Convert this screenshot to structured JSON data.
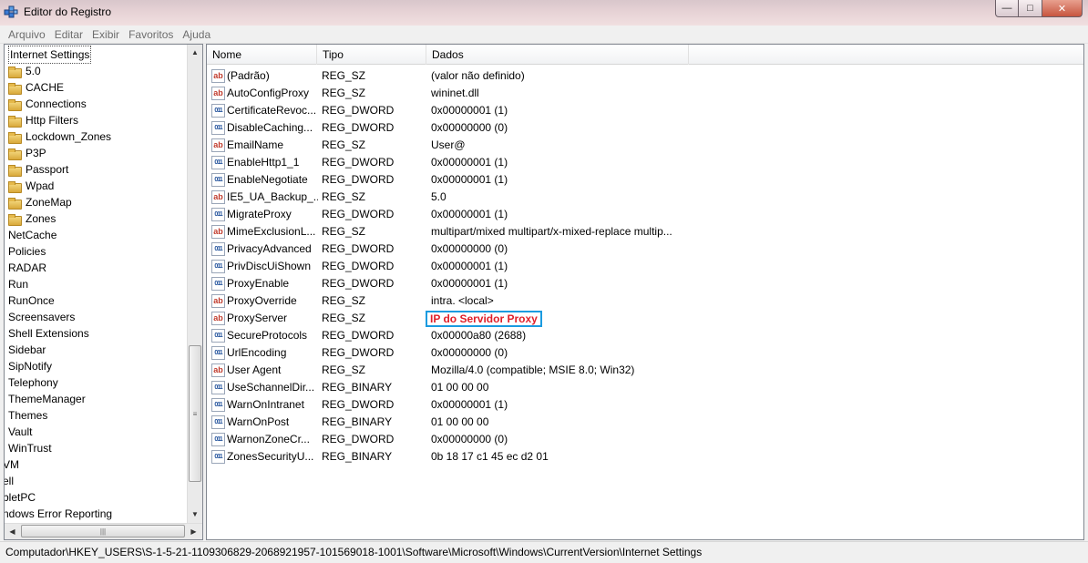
{
  "window": {
    "title": "Editor do Registro",
    "icons": {
      "app": "registry-editor-icon",
      "minimize": "minimize-icon",
      "maximize": "maximize-icon",
      "close": "close-icon"
    }
  },
  "menu": [
    "Arquivo",
    "Editar",
    "Exibir",
    "Favoritos",
    "Ajuda"
  ],
  "tree": [
    {
      "label": "Internet Settings",
      "folder": false,
      "selected": true,
      "indent": 1
    },
    {
      "label": "5.0",
      "folder": true,
      "indent": 1
    },
    {
      "label": "CACHE",
      "folder": true,
      "indent": 1
    },
    {
      "label": "Connections",
      "folder": true,
      "indent": 1
    },
    {
      "label": "Http Filters",
      "folder": true,
      "indent": 1
    },
    {
      "label": "Lockdown_Zones",
      "folder": true,
      "indent": 1
    },
    {
      "label": "P3P",
      "folder": true,
      "indent": 1
    },
    {
      "label": "Passport",
      "folder": true,
      "indent": 1
    },
    {
      "label": "Wpad",
      "folder": true,
      "indent": 1
    },
    {
      "label": "ZoneMap",
      "folder": true,
      "indent": 1
    },
    {
      "label": "Zones",
      "folder": true,
      "indent": 1
    },
    {
      "label": "NetCache",
      "folder": false,
      "indent": 1
    },
    {
      "label": "Policies",
      "folder": false,
      "indent": 1
    },
    {
      "label": "RADAR",
      "folder": false,
      "indent": 1
    },
    {
      "label": "Run",
      "folder": false,
      "indent": 1
    },
    {
      "label": "RunOnce",
      "folder": false,
      "indent": 1
    },
    {
      "label": "Screensavers",
      "folder": false,
      "indent": 1
    },
    {
      "label": "Shell Extensions",
      "folder": false,
      "indent": 1
    },
    {
      "label": "Sidebar",
      "folder": false,
      "indent": 1
    },
    {
      "label": "SipNotify",
      "folder": false,
      "indent": 1
    },
    {
      "label": "Telephony",
      "folder": false,
      "indent": 1
    },
    {
      "label": "ThemeManager",
      "folder": false,
      "indent": 1
    },
    {
      "label": "Themes",
      "folder": false,
      "indent": 1
    },
    {
      "label": "Vault",
      "folder": false,
      "indent": 1
    },
    {
      "label": "WinTrust",
      "folder": false,
      "indent": 1
    },
    {
      "label": "VM",
      "folder": false,
      "indent": 0
    },
    {
      "label": "ell",
      "folder": false,
      "indent": 0
    },
    {
      "label": "bletPC",
      "folder": false,
      "indent": 0
    },
    {
      "label": "ndows Error Reporting",
      "folder": false,
      "indent": 0
    }
  ],
  "columns": {
    "name": "Nome",
    "type": "Tipo",
    "data": "Dados"
  },
  "values": [
    {
      "name": "(Padrão)",
      "type": "REG_SZ",
      "data": "(valor não definido)",
      "kind": "str"
    },
    {
      "name": "AutoConfigProxy",
      "type": "REG_SZ",
      "data": "wininet.dll",
      "kind": "str"
    },
    {
      "name": "CertificateRevoc...",
      "type": "REG_DWORD",
      "data": "0x00000001 (1)",
      "kind": "bin"
    },
    {
      "name": "DisableCaching...",
      "type": "REG_DWORD",
      "data": "0x00000000 (0)",
      "kind": "bin"
    },
    {
      "name": "EmailName",
      "type": "REG_SZ",
      "data": "User@",
      "kind": "str"
    },
    {
      "name": "EnableHttp1_1",
      "type": "REG_DWORD",
      "data": "0x00000001 (1)",
      "kind": "bin"
    },
    {
      "name": "EnableNegotiate",
      "type": "REG_DWORD",
      "data": "0x00000001 (1)",
      "kind": "bin"
    },
    {
      "name": "IE5_UA_Backup_...",
      "type": "REG_SZ",
      "data": "5.0",
      "kind": "str"
    },
    {
      "name": "MigrateProxy",
      "type": "REG_DWORD",
      "data": "0x00000001 (1)",
      "kind": "bin"
    },
    {
      "name": "MimeExclusionL...",
      "type": "REG_SZ",
      "data": "multipart/mixed multipart/x-mixed-replace multip...",
      "kind": "str"
    },
    {
      "name": "PrivacyAdvanced",
      "type": "REG_DWORD",
      "data": "0x00000000 (0)",
      "kind": "bin"
    },
    {
      "name": "PrivDiscUiShown",
      "type": "REG_DWORD",
      "data": "0x00000001 (1)",
      "kind": "bin"
    },
    {
      "name": "ProxyEnable",
      "type": "REG_DWORD",
      "data": "0x00000001 (1)",
      "kind": "bin"
    },
    {
      "name": "ProxyOverride",
      "type": "REG_SZ",
      "data": "intra. <local>",
      "kind": "str"
    },
    {
      "name": "ProxyServer",
      "type": "REG_SZ",
      "data": "IP do Servidor Proxy",
      "kind": "str",
      "highlight": true
    },
    {
      "name": "SecureProtocols",
      "type": "REG_DWORD",
      "data": "0x00000a80 (2688)",
      "kind": "bin"
    },
    {
      "name": "UrlEncoding",
      "type": "REG_DWORD",
      "data": "0x00000000 (0)",
      "kind": "bin"
    },
    {
      "name": "User Agent",
      "type": "REG_SZ",
      "data": "Mozilla/4.0 (compatible; MSIE 8.0; Win32)",
      "kind": "str"
    },
    {
      "name": "UseSchannelDir...",
      "type": "REG_BINARY",
      "data": "01 00 00 00",
      "kind": "bin"
    },
    {
      "name": "WarnOnIntranet",
      "type": "REG_DWORD",
      "data": "0x00000001 (1)",
      "kind": "bin"
    },
    {
      "name": "WarnOnPost",
      "type": "REG_BINARY",
      "data": "01 00 00 00",
      "kind": "bin"
    },
    {
      "name": "WarnonZoneCr...",
      "type": "REG_DWORD",
      "data": "0x00000000 (0)",
      "kind": "bin"
    },
    {
      "name": "ZonesSecurityU...",
      "type": "REG_BINARY",
      "data": "0b 18 17 c1 45 ec d2 01",
      "kind": "bin"
    }
  ],
  "status": "Computador\\HKEY_USERS\\S-1-5-21-1109306829-2068921957-101569018-1001\\Software\\Microsoft\\Windows\\CurrentVersion\\Internet Settings",
  "colors": {
    "highlight_border": "#1b9be0",
    "highlight_text": "#e0202a"
  }
}
